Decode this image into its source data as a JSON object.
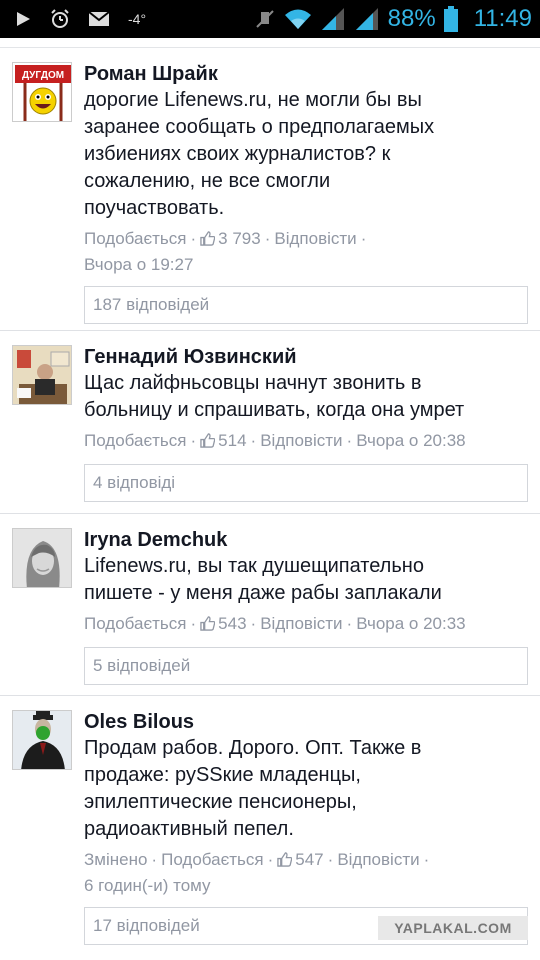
{
  "statusbar": {
    "temp": "-4°",
    "battery_pct": "88%",
    "time": "11:49"
  },
  "comments": [
    {
      "author": "Роман Шрайк",
      "lines": [
        "дорогие Lifenews.ru, не могли бы вы",
        "заранее сообщать о предполагаемых",
        "избиениях своих журналистов? к",
        "сожалению, не все смогли",
        "поучаствовать."
      ],
      "edited": "",
      "like_label": "Подобається",
      "likes": "3 793",
      "reply_label": "Відповісти",
      "time": "Вчора о 19:27",
      "replies": "187 відповідей"
    },
    {
      "author": "Геннадий Юзвинский",
      "lines": [
        "Щас лайфньсовцы начнут звонить в",
        "больницу и спрашивать, когда она умрет"
      ],
      "edited": "",
      "like_label": "Подобається",
      "likes": "514",
      "reply_label": "Відповісти",
      "time": "Вчора о 20:38",
      "replies": "4 відповіді"
    },
    {
      "author": "Iryna Demchuk",
      "lines": [
        "Lifenews.ru, вы так душещипательно",
        "пишете - у меня даже рабы заплакали"
      ],
      "edited": "",
      "like_label": "Подобається",
      "likes": "543",
      "reply_label": "Відповісти",
      "time": "Вчора о 20:33",
      "replies": "5 відповідей"
    },
    {
      "author": "Oles Bilous",
      "lines": [
        "Продам рабов. Дорого. Опт. Также в",
        "продаже: руSSкие младенцы,",
        "эпилептические пенсионеры,",
        "радиоактивный пепел."
      ],
      "edited": "Змінено",
      "like_label": "Подобається",
      "likes": "547",
      "reply_label": "Відповісти",
      "time": "6 годин(-и) тому",
      "replies": "17 відповідей"
    }
  ],
  "avatar_logo_text": "ДУГДОМ",
  "watermark": "YAPLAKAL.COM",
  "colors": {
    "accent": "#33b5e5",
    "meta": "#9197a3",
    "text": "#141823"
  }
}
